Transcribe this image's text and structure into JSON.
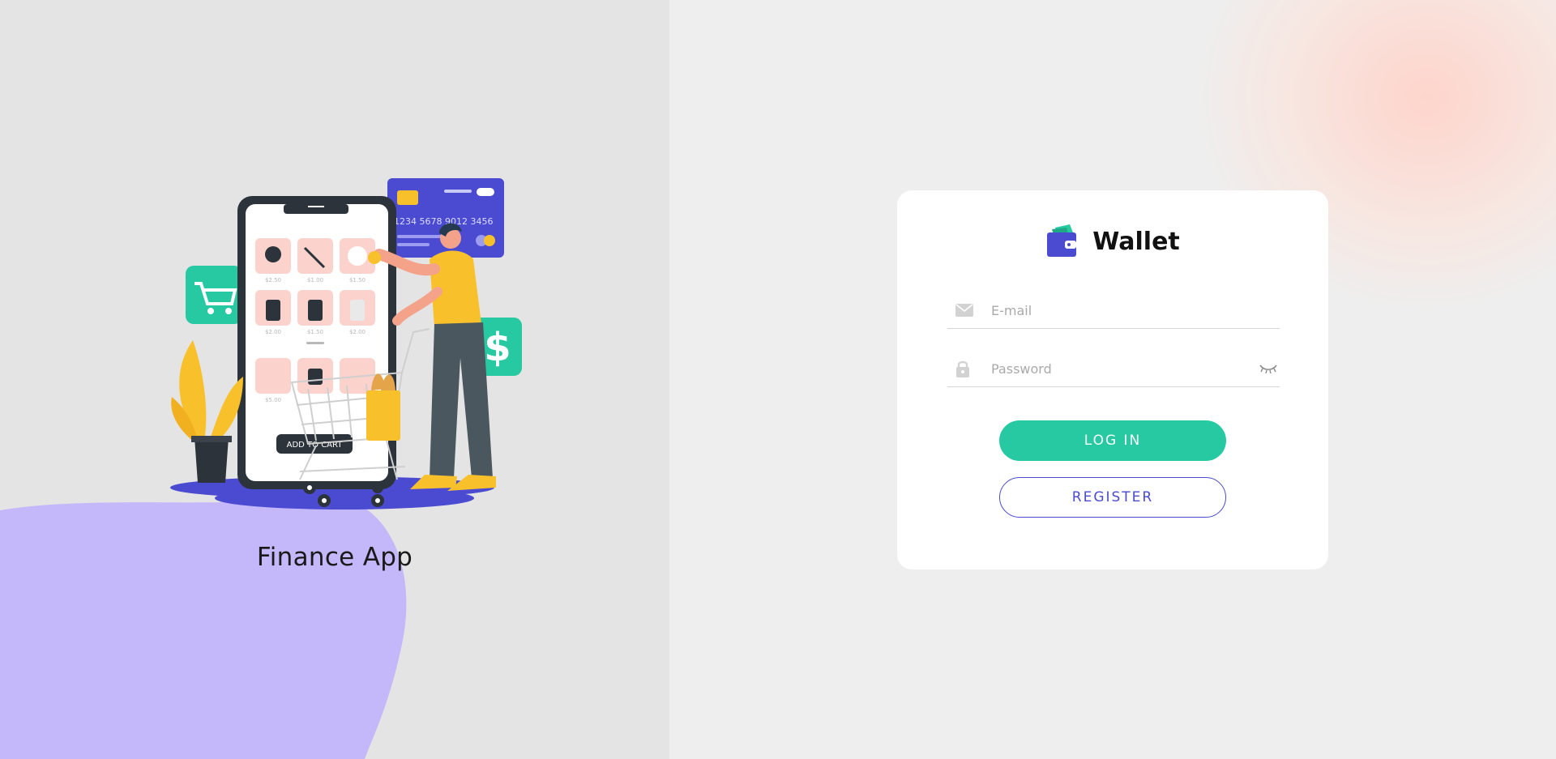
{
  "left": {
    "caption": "Finance App",
    "illustration": {
      "card_number": "1234 5678 9012 3456",
      "add_to_cart_label": "ADD TO CART",
      "prices_row1": [
        "$2.50",
        "$1.00",
        "$1.50"
      ],
      "prices_row2": [
        "$2.00",
        "$1.50",
        "$2.00"
      ],
      "price_row3": "$5.00",
      "dollar_sign": "$",
      "icons": [
        "shopping-cart-icon",
        "dollar-icon",
        "credit-card-icon",
        "phone-icon",
        "plant-icon",
        "person-icon"
      ]
    }
  },
  "brand": {
    "name": "Wallet",
    "icon": "wallet-icon"
  },
  "form": {
    "email": {
      "placeholder": "E-mail",
      "value": "",
      "icon": "mail-icon"
    },
    "password": {
      "placeholder": "Password",
      "value": "",
      "icon": "lock-icon",
      "toggle_icon": "eye-closed-icon"
    }
  },
  "buttons": {
    "login_label": "LOG IN",
    "register_label": "REGISTER"
  },
  "colors": {
    "accent_green": "#26c9a1",
    "accent_indigo": "#4a4bd1",
    "blob_purple": "#c4b8fb",
    "card_bg": "#ffffff"
  }
}
